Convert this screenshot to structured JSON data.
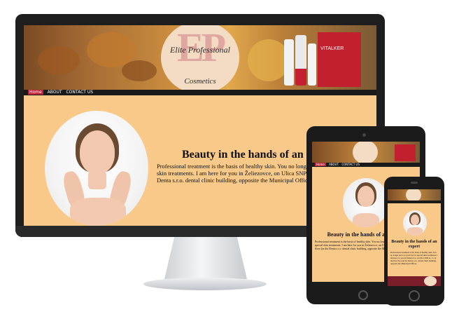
{
  "brand": {
    "logo_letters": "EP",
    "logo_name": "Elite Professional",
    "logo_sub": "Cosmetics",
    "product_label": "VITALKER"
  },
  "nav": {
    "home": "Home",
    "about": "ABOUT",
    "contact": "CONTACT US"
  },
  "desktop": {
    "heading": "Beauty in the hands of an expert",
    "body": "Professional treatment is the basis of healthy skin. You no longer have to travel far for special skin treatments. I am here for you in Želiezovce, on Ulica SNP no. 3, on the first floor (in the Denta s.r.o. dental clinic building, opposite the Municipal Office)."
  },
  "tablet": {
    "heading": "Beauty in the hands of an expert",
    "body": "Professional treatment is the basis of healthy skin. You no longer have to travel far for special skin treatments. I am here for you in Želiezovce, on Ulica SNP no. 3, on the first floor (in the Denta s.r.o. dental clinic building, opposite the Municipal Office)."
  },
  "phone": {
    "heading": "Beauty in the hands of an expert",
    "body": "Professional treatment is the basis of healthy skin. You no longer have to travel far for special skin treatments. I am here for you in Želiezovce, on Ulica SNP no. 3, on the first floor (in the Denta s.r.o. dental clinic building, opposite the Municipal Office)."
  },
  "colors": {
    "page_bg": "#f9c98a",
    "nav_bg": "#1a1a1a",
    "nav_home": "#c0243a",
    "device_frame": "#1b1b1b"
  }
}
